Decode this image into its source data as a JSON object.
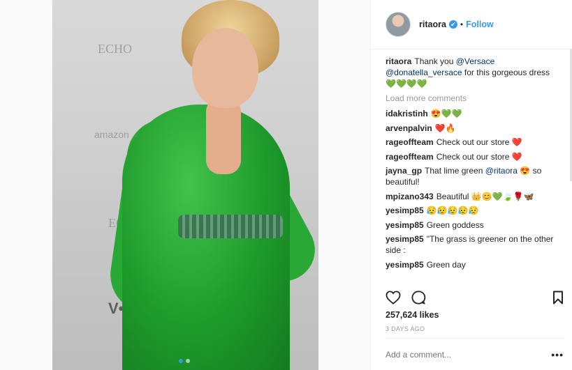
{
  "post": {
    "username": "ritaora",
    "verified_icon": "✔",
    "dot": "•",
    "follow_label": "Follow",
    "photo": {
      "dots_count": 2,
      "active_dot": 0
    }
  },
  "caption": {
    "user": "ritaora",
    "text_1": "Thank you ",
    "mention_1": "@Versace",
    "mention_2": "@donatella_versace",
    "text_2": " for this gorgeous dress ",
    "emoji": "💚💚💚💚"
  },
  "load_more": "Load more comments",
  "comments": [
    {
      "user": "idakristinh",
      "text": "",
      "emoji": "😍💚💚"
    },
    {
      "user": "arvenpalvin",
      "text": "",
      "emoji": "❤️🔥"
    },
    {
      "user": "rageoffteam",
      "text": "Check out our store ",
      "emoji": "❤️"
    },
    {
      "user": "rageoffteam",
      "text": "Check out our store ",
      "emoji": "❤️"
    },
    {
      "user": "jayna_gp",
      "text": "That lime green ",
      "mention": "@ritaora",
      "text_after": " ",
      "emoji": "😍",
      "text_end": " so beautiful!"
    },
    {
      "user": "mpizano343",
      "text": "Beautiful ",
      "emoji": "👑😊💚🍃🌹🦋"
    },
    {
      "user": "yesimp85",
      "text": "",
      "emoji": "😥😥😥😥😥"
    },
    {
      "user": "yesimp85",
      "text": "Green goddess",
      "emoji": ""
    },
    {
      "user": "yesimp85",
      "text": "\"The grass is greener on the other side :",
      "emoji": ""
    },
    {
      "user": "yesimp85",
      "text": "Green day",
      "emoji": ""
    }
  ],
  "likes": "257,624 likes",
  "time": "3 DAYS AGO",
  "add_comment_placeholder": "Add a comment...",
  "more_label": "•••",
  "colors": {
    "link": "#3897f0",
    "verified": "#3897f0",
    "mention": "#003569"
  },
  "icons": [
    "heart-icon",
    "comment-icon",
    "bookmark-icon",
    "verified-icon"
  ]
}
